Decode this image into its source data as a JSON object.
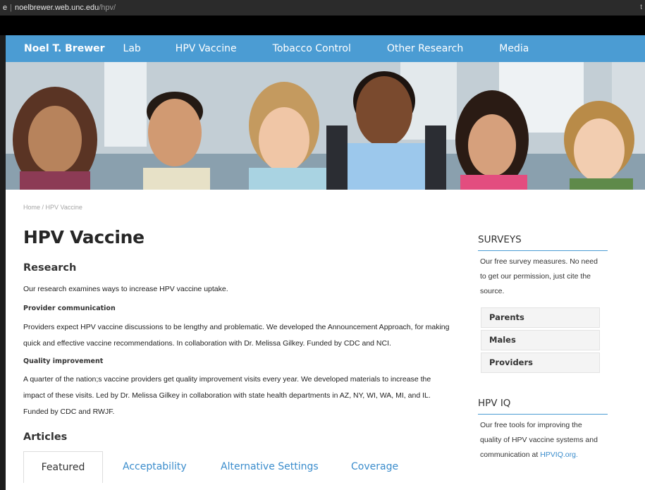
{
  "browser": {
    "tab_fragment": "e",
    "url_host": "noelbrewer.web.unc.edu",
    "url_path": "/hpv/",
    "right_glyph": "t"
  },
  "nav": {
    "brand": "Noel T. Brewer",
    "items": [
      "Lab",
      "HPV Vaccine",
      "Tobacco Control",
      "Other Research",
      "Media"
    ],
    "color": "#4b9cd3"
  },
  "breadcrumb": {
    "home": "Home",
    "separator": " / ",
    "current": "HPV Vaccine"
  },
  "main": {
    "title": "HPV Vaccine",
    "research_heading": "Research",
    "research_intro": "Our research examines ways to increase HPV vaccine uptake.",
    "provider_heading": "Provider communication",
    "provider_text": "Providers expect HPV vaccine discussions to be lengthy and problematic. We developed the Announcement Approach, for making quick and effective vaccine recommendations. In collaboration with Dr. Melissa Gilkey. Funded by CDC and NCI.",
    "quality_heading": "Quality improvement",
    "quality_text": "A quarter of the nation;s vaccine providers get quality improvement visits every year. We developed materials to increase the impact of these visits. Led by Dr. Melissa Gilkey in collaboration with state health departments in AZ, NY, WI, WA, MI, and IL. Funded by CDC and RWJF.",
    "articles_heading": "Articles",
    "tabs": [
      "Featured",
      "Acceptability",
      "Alternative Settings",
      "Coverage"
    ],
    "link_color": "#3a8ccc"
  },
  "sidebar": {
    "surveys_heading": "SURVEYS",
    "surveys_text": "Our free survey measures. No need to get our permission, just cite the source.",
    "surveys_buttons": [
      "Parents",
      "Males",
      "Providers"
    ],
    "hpviq_heading": "HPV IQ",
    "hpviq_text": "Our free tools for improving the quality of HPV vaccine systems and communication at",
    "hpviq_link": "HPVIQ.org."
  }
}
